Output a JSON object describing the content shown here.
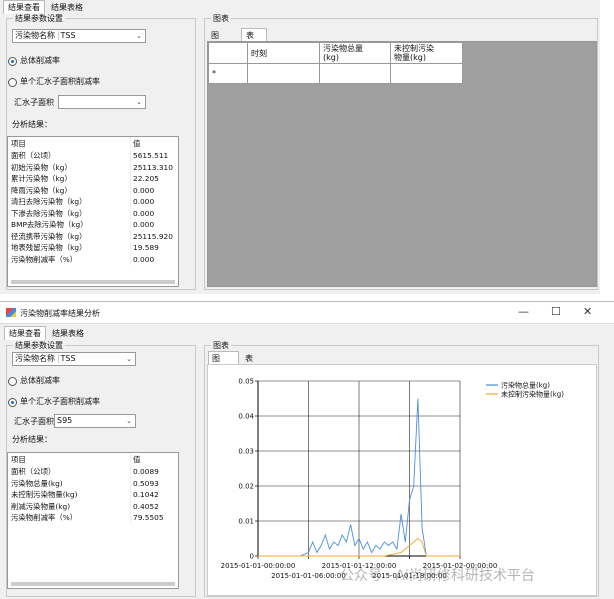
{
  "top": {
    "tabs": [
      "结果查看",
      "结果表格"
    ],
    "params_title": "结果参数设置",
    "pollutant_label": "污染物名称",
    "pollutant_value": "TSS",
    "radio_total": "总体削减率",
    "radio_single": "单个汇水子面积削减率",
    "catchment_label": "汇水子面积",
    "catchment_value": "",
    "analysis_label": "分析结果：",
    "list_header": {
      "item": "项目",
      "value": "值"
    },
    "rows": [
      {
        "item": "面积（公顷）",
        "value": "5615.511"
      },
      {
        "item": "初始污染物（kg）",
        "value": "25113.310"
      },
      {
        "item": "累计污染物（kg）",
        "value": "22.205"
      },
      {
        "item": "降雨污染物（kg）",
        "value": "0.000"
      },
      {
        "item": "清扫去除污染物（kg）",
        "value": "0.000"
      },
      {
        "item": "下渗去除污染物（kg）",
        "value": "0.000"
      },
      {
        "item": "BMP去除污染物（kg）",
        "value": "0.000"
      },
      {
        "item": "径流携带污染物（kg）",
        "value": "25115.920"
      },
      {
        "item": "地表残留污染物（kg）",
        "value": "19.589"
      },
      {
        "item": "污染物削减率（%）",
        "value": "0.000"
      }
    ],
    "chart_group_title": "图表",
    "chart_tabs": [
      "图",
      "表"
    ],
    "grid_headers": [
      "时刻",
      "污染物总量\n(kg)",
      "未控制污染\n物量(kg)"
    ],
    "grid_new_row_marker": "*"
  },
  "bottom": {
    "window_title": "污染物削减率结果分析",
    "tabs": [
      "结果查看",
      "结果表格"
    ],
    "params_title": "结果参数设置",
    "pollutant_label": "污染物名称",
    "pollutant_value": "TSS",
    "radio_total": "总体削减率",
    "radio_single": "单个汇水子面积削减率",
    "catchment_label": "汇水子面积",
    "catchment_value": "S95",
    "analysis_label": "分析结果：",
    "list_header": {
      "item": "项目",
      "value": "值"
    },
    "rows": [
      {
        "item": "面积（公顷）",
        "value": "0.0089"
      },
      {
        "item": "污染物总量(kg)",
        "value": "0.5093"
      },
      {
        "item": "未控制污染物量(kg)",
        "value": "0.1042"
      },
      {
        "item": "削减污染物量(kg)",
        "value": "0.4052"
      },
      {
        "item": "污染物削减率（%）",
        "value": "79.5505"
      }
    ],
    "chart_group_title": "图表",
    "chart_tabs": [
      "图",
      "表"
    ]
  },
  "watermark": "公众号 · Ai尚研修科研技术平台",
  "chart_data": {
    "type": "line",
    "title": "",
    "xlabel": "",
    "ylabel": "",
    "ylim": [
      0,
      0.05
    ],
    "yticks": [
      "0",
      "0.01",
      "0.02",
      "0.03",
      "0.04",
      "0.05"
    ],
    "xticks_upper": [
      "2015-01-01-00:00:00",
      "2015-01-01-12:00:00",
      "2015-01-02-00:00:00"
    ],
    "xticks_lower": [
      "2015-01-01-06:00:00",
      "2015-01-01-18:00:00"
    ],
    "grid": true,
    "legend_position": "top-right",
    "series": [
      {
        "name": "污染物总量(kg)",
        "color": "#4a90d9",
        "x": [
          0,
          1,
          2,
          3,
          4,
          5,
          6,
          6.5,
          7,
          7.5,
          8,
          8.5,
          9,
          9.5,
          10,
          10.5,
          11,
          11.5,
          12,
          12.5,
          13,
          13.5,
          14,
          14.5,
          15,
          15.5,
          16,
          16.5,
          17,
          17.5,
          18,
          18.5,
          19,
          19.5,
          20,
          20.5,
          21,
          21.5,
          22,
          22.5,
          23,
          23.5,
          24
        ],
        "y": [
          0,
          0,
          0,
          0,
          0,
          0,
          0.001,
          0.004,
          0.001,
          0.003,
          0.006,
          0.002,
          0.004,
          0.003,
          0.006,
          0.004,
          0.009,
          0.003,
          0.005,
          0.002,
          0.004,
          0.001,
          0.003,
          0.002,
          0.004,
          0.003,
          0.004,
          0.002,
          0.012,
          0.004,
          0.016,
          0.02,
          0.045,
          0.008,
          0,
          0,
          0,
          0,
          0,
          0,
          0,
          0,
          0
        ]
      },
      {
        "name": "未控制污染物量(kg)",
        "color": "#f0a830",
        "x": [
          0,
          6,
          10,
          12,
          14,
          15,
          16,
          17,
          17.5,
          18,
          18.5,
          19,
          19.5,
          20,
          24
        ],
        "y": [
          0,
          0,
          0,
          0,
          0,
          0,
          0.0005,
          0.001,
          0.002,
          0.003,
          0.004,
          0.005,
          0.004,
          0,
          0
        ]
      }
    ]
  }
}
